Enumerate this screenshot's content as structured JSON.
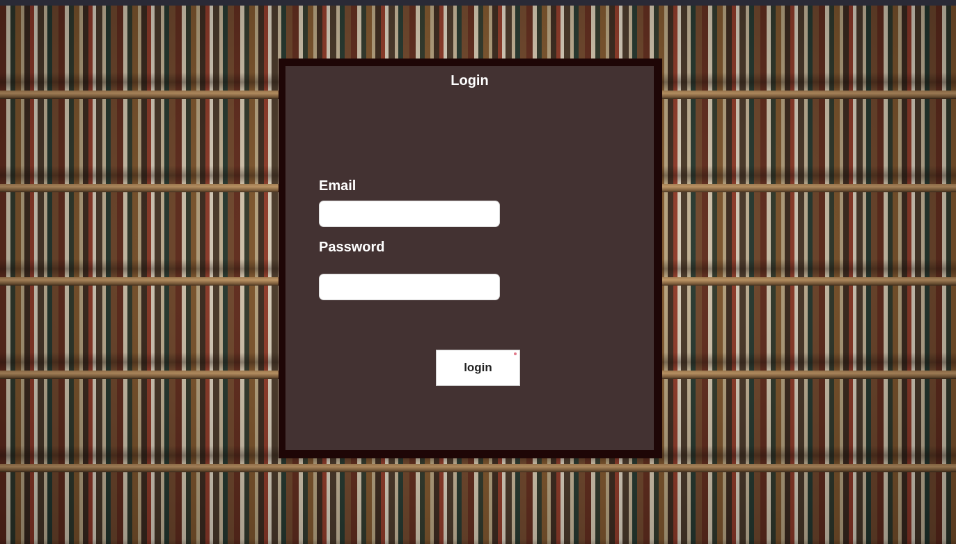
{
  "login_form": {
    "title": "Login",
    "email_label": "Email",
    "email_value": "",
    "password_label": "Password",
    "password_value": "",
    "submit_label": "login"
  },
  "colors": {
    "panel_background": "#433232",
    "panel_border": "#1e0606",
    "text": "#ffffff",
    "input_background": "#ffffff",
    "button_background": "#ffffff"
  },
  "background": {
    "image_subject": "bookshelf"
  }
}
